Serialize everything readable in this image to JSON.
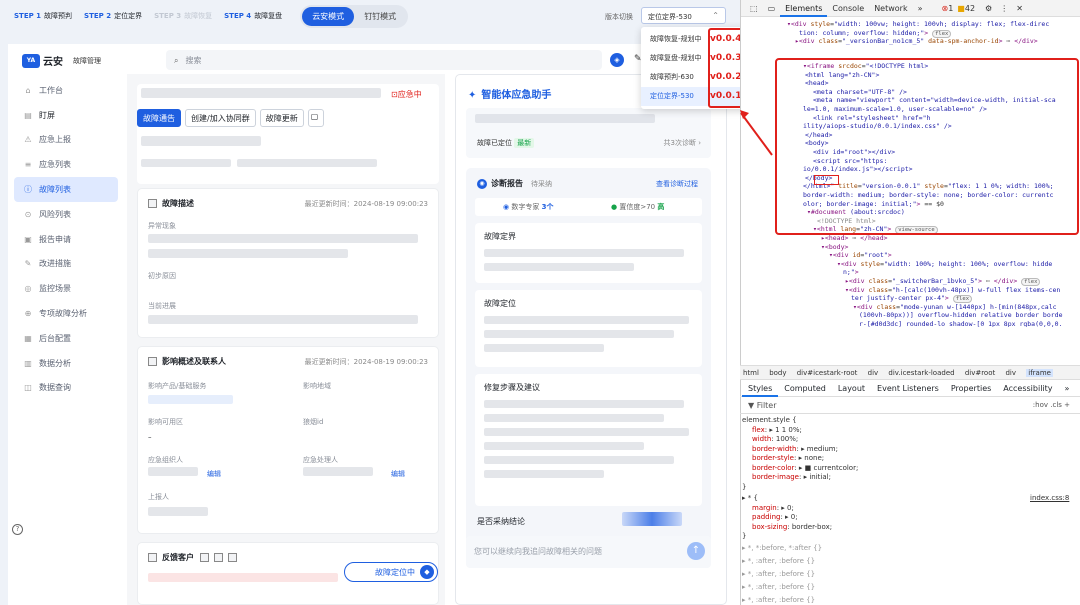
{
  "steps": [
    {
      "num": "STEP 1",
      "label": "故障预判",
      "disabled": false
    },
    {
      "num": "STEP 2",
      "label": "定位定界",
      "disabled": false
    },
    {
      "num": "STEP 3",
      "label": "故障恢复",
      "disabled": true
    },
    {
      "num": "STEP 4",
      "label": "故障复盘",
      "disabled": false
    }
  ],
  "modes": [
    "云安模式",
    "钉钉模式"
  ],
  "version": {
    "label": "版本切换",
    "selected": "定位定界-530",
    "options": [
      {
        "label": "故障恢复-规划中",
        "ver": "v0.0.4"
      },
      {
        "label": "故障复盘-规划中",
        "ver": "v0.0.3"
      },
      {
        "label": "故障预判-630",
        "ver": "v0.0.2"
      },
      {
        "label": "定位定界-530",
        "ver": "v0.0.1"
      }
    ]
  },
  "logo": {
    "badge": "YA",
    "name": "云安",
    "module": "故障管理"
  },
  "search": {
    "placeholder": "搜索"
  },
  "nav": [
    {
      "icon": "⌂",
      "label": "工作台"
    },
    {
      "icon": "▤",
      "label": "盯屏"
    },
    {
      "icon": "⚠",
      "label": "应急上报"
    },
    {
      "icon": "≡",
      "label": "应急列表"
    },
    {
      "icon": "ⓘ",
      "label": "故障列表"
    },
    {
      "icon": "⊙",
      "label": "风险列表"
    },
    {
      "icon": "▣",
      "label": "报告申请"
    },
    {
      "icon": "✎",
      "label": "改进措施"
    },
    {
      "icon": "◎",
      "label": "监控场景"
    },
    {
      "icon": "⊕",
      "label": "专项故障分析"
    },
    {
      "icon": "▦",
      "label": "后台配置"
    },
    {
      "icon": "▥",
      "label": "数据分析"
    },
    {
      "icon": "◫",
      "label": "数据查询"
    }
  ],
  "help": "?",
  "incident": {
    "emergency_tag": "应急中",
    "tabs": [
      "故障通告",
      "创建/加入协同群",
      "故障更新"
    ]
  },
  "desc": {
    "title": "故障描述",
    "updated": "最近更新时间：2024-08-19 09:00:23",
    "fields": [
      "异常现象",
      "初步原因",
      "当前进展"
    ]
  },
  "impact": {
    "title": "影响概述及联系人",
    "updated": "最近更新时间：2024-08-19 09:00:23",
    "fields": [
      "影响产品/基础服务",
      "影响地域",
      "影响可用区",
      "狼烟id",
      "应急组织人",
      "应急处理人",
      "上报人"
    ],
    "dash": "–",
    "edit": "编辑"
  },
  "customer": {
    "title": "反馈客户"
  },
  "float_btn": "故障定位中",
  "ai": {
    "title": "智能体应急助手",
    "located": "故障已定位",
    "latest": "最新",
    "diag_count": "共3次诊断 ›",
    "report_title": "诊断报告",
    "report_status": "待采纳",
    "report_link": "查看诊断过程",
    "experts": "数字专家",
    "experts_n": "3个",
    "confidence": "置信度>70",
    "confidence_lvl": "高",
    "cards": [
      "故障定界",
      "故障定位",
      "修复步骤及建议"
    ],
    "adopt_q": "是否采纳结论",
    "input_placeholder": "您可以继续向我追问故障相关的问题"
  },
  "devtools": {
    "tabs": [
      "Elements",
      "Console",
      "Network",
      "»"
    ],
    "errors": "1",
    "warnings": "42",
    "crumbs": [
      "html",
      "body",
      "div#icestark-root",
      "div",
      "div.icestark-loaded",
      "div#root",
      "div",
      "iframe"
    ],
    "style_tabs": [
      "Styles",
      "Computed",
      "Layout",
      "Event Listeners",
      "Properties",
      "Accessibility",
      "»"
    ],
    "filter": "Filter",
    "filter_tools": ":hov  .cls  +",
    "css_file": "index.css:8"
  },
  "colors": {
    "accent": "#1f5fe0",
    "danger": "#e0201b",
    "success": "#16a34a"
  }
}
